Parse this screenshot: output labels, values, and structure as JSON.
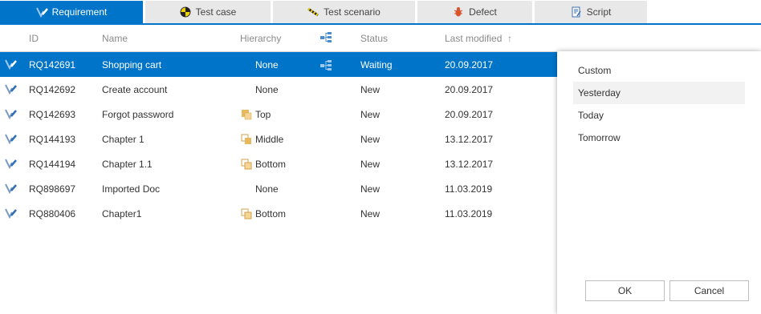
{
  "tabs": [
    {
      "label": "Requirement",
      "icon": "requirement-icon",
      "active": true
    },
    {
      "label": "Test case",
      "icon": "test-case-icon",
      "active": false
    },
    {
      "label": "Test scenario",
      "icon": "test-scenario-icon",
      "active": false
    },
    {
      "label": "Defect",
      "icon": "bug-icon",
      "active": false
    },
    {
      "label": "Script",
      "icon": "script-icon",
      "active": false
    }
  ],
  "columns": {
    "id": "ID",
    "name": "Name",
    "hierarchy": "Hierarchy",
    "status": "Status",
    "last_modified": "Last modified",
    "sort_arrow": "↑"
  },
  "rows": [
    {
      "id": "RQ142691",
      "name": "Shopping cart",
      "hierarchy": "None",
      "status": "Waiting",
      "modified": "20.09.2017"
    },
    {
      "id": "RQ142692",
      "name": "Create account",
      "hierarchy": "None",
      "status": "New",
      "modified": "20.09.2017"
    },
    {
      "id": "RQ142693",
      "name": "Forgot password",
      "hierarchy": "Top",
      "status": "New",
      "modified": "20.09.2017"
    },
    {
      "id": "RQ144193",
      "name": "Chapter 1",
      "hierarchy": "Middle",
      "status": "New",
      "modified": "13.12.2017"
    },
    {
      "id": "RQ144194",
      "name": "Chapter 1.1",
      "hierarchy": "Bottom",
      "status": "New",
      "modified": "13.12.2017"
    },
    {
      "id": "RQ898697",
      "name": "Imported Doc",
      "hierarchy": "None",
      "status": "New",
      "modified": "11.03.2019"
    },
    {
      "id": "RQ880406",
      "name": "Chapter1",
      "hierarchy": "Bottom",
      "status": "New",
      "modified": "11.03.2019"
    }
  ],
  "dropdown": {
    "options": [
      "Custom",
      "Yesterday",
      "Today",
      "Tomorrow"
    ],
    "hovered": "Yesterday",
    "ok_label": "OK",
    "cancel_label": "Cancel"
  },
  "colors": {
    "accent": "#0074c8",
    "tab_bg": "#e8e8e8",
    "hierarchy_icon": "#e8b85c"
  }
}
